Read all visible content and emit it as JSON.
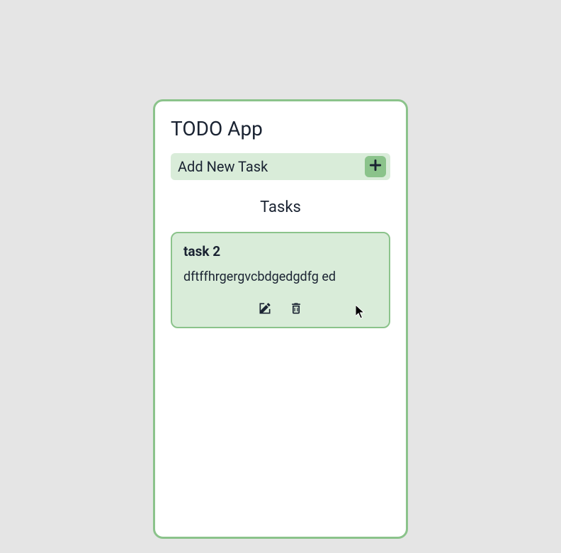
{
  "app": {
    "title": "TODO App"
  },
  "addTask": {
    "label": "Add New Task"
  },
  "tasksSection": {
    "heading": "Tasks"
  },
  "tasks": [
    {
      "title": "task 2",
      "description": "dftffhrgergvcbdgedgdfg ed"
    }
  ],
  "icons": {
    "plus": "plus-icon",
    "edit": "edit-icon",
    "delete": "trash-icon"
  }
}
